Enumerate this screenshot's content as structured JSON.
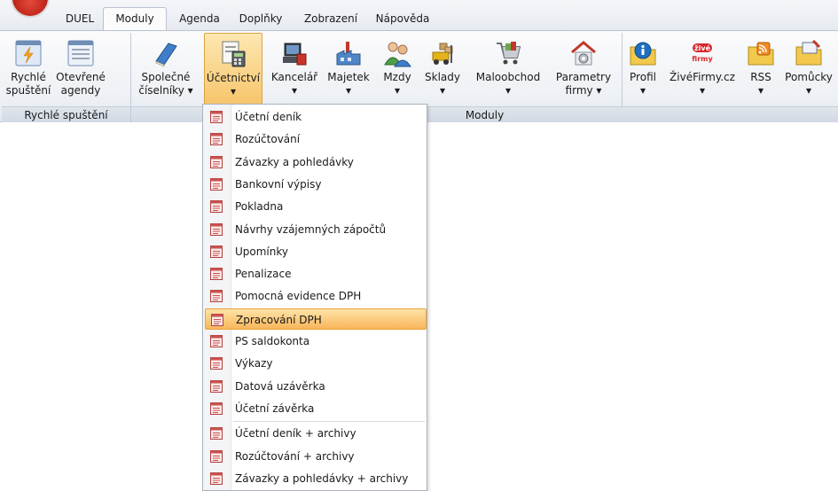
{
  "tabs": [
    {
      "label": "DUEL",
      "active": false
    },
    {
      "label": "Moduly",
      "active": true
    },
    {
      "label": "Agenda",
      "active": false
    },
    {
      "label": "Doplňky",
      "active": false
    },
    {
      "label": "Zobrazení",
      "active": false
    },
    {
      "label": "Nápověda",
      "active": false
    }
  ],
  "ribbon": {
    "groups": [
      {
        "label": "Rychlé spuštění"
      },
      {
        "label": "Moduly"
      }
    ],
    "buttons": [
      {
        "line1": "Rychlé",
        "line2": "spuštění",
        "icon": "lightning-icon"
      },
      {
        "line1": "Otevřené",
        "line2": "agendy",
        "icon": "window-list-icon"
      },
      {
        "line1": "Společné",
        "line2": "číselníky ▾",
        "icon": "book-icon"
      },
      {
        "line1": "Účetnictví",
        "line2": "▾",
        "icon": "accounting-icon"
      },
      {
        "line1": "Kancelář",
        "line2": "▾",
        "icon": "office-icon"
      },
      {
        "line1": "Majetek",
        "line2": "▾",
        "icon": "factory-icon"
      },
      {
        "line1": "Mzdy",
        "line2": "▾",
        "icon": "people-icon"
      },
      {
        "line1": "Sklady",
        "line2": "▾",
        "icon": "forklift-icon"
      },
      {
        "line1": "Maloobchod",
        "line2": "▾",
        "icon": "shopping-cart-icon"
      },
      {
        "line1": "Parametry",
        "line2": "firmy ▾",
        "icon": "house-gear-icon"
      },
      {
        "line1": "Profil",
        "line2": "▾",
        "icon": "info-folder-icon"
      },
      {
        "line1": "ŽivéFirmy.cz",
        "line2": "▾",
        "icon": "zivefirmy-logo-icon"
      },
      {
        "line1": "RSS",
        "line2": "▾",
        "icon": "rss-folder-icon"
      },
      {
        "line1": "Pomůcky",
        "line2": "▾",
        "icon": "tools-folder-icon"
      }
    ]
  },
  "logo_text": {
    "zive": "živé",
    "firmy": "firmy"
  },
  "menu": {
    "items": [
      "Účetní deník",
      "Rozúčtování",
      "Závazky a pohledávky",
      "Bankovní výpisy",
      "Pokladna",
      "Návrhy vzájemných zápočtů",
      "Upomínky",
      "Penalizace",
      "Pomocná evidence DPH",
      "Zpracování DPH",
      "PS saldokonta",
      "Výkazy",
      "Datová uzávěrka",
      "Účetní závěrka",
      "Účetní deník + archivy",
      "Rozúčtování + archivy",
      "Závazky a pohledávky + archivy"
    ],
    "highlighted": "Zpracování DPH"
  },
  "colors": {
    "highlight": "#f9b65a",
    "ribbon_bg": "#eef1f5",
    "orb": "#c0281b"
  }
}
